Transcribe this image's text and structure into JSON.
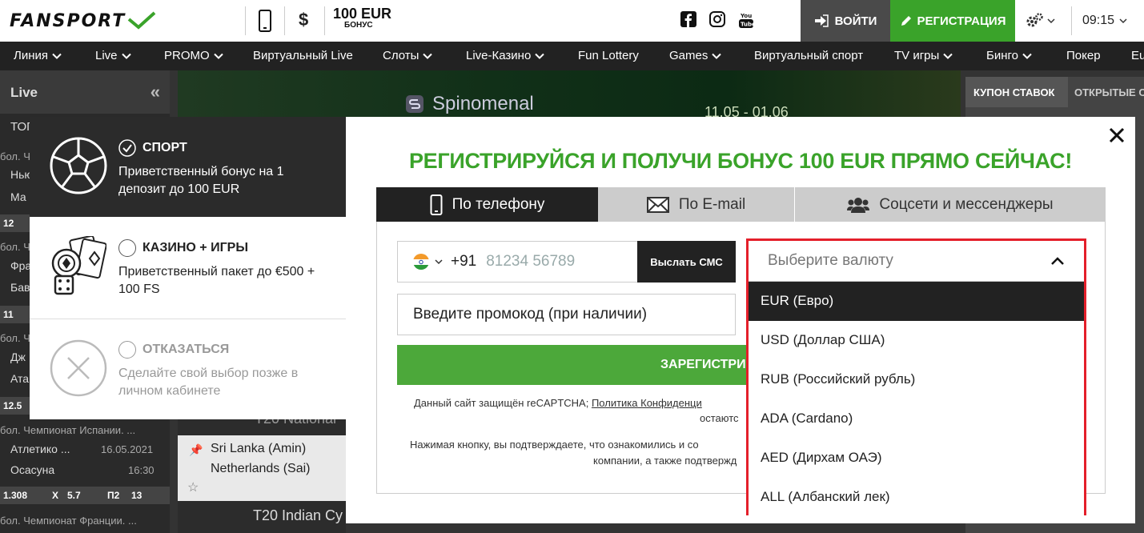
{
  "header": {
    "logo_text": "FANSPORT",
    "bonus_amount": "100 EUR",
    "bonus_label": "БОНУС",
    "login_label": "ВОЙТИ",
    "register_label": "РЕГИСТРАЦИЯ",
    "time": "09:15",
    "currency_symbol": "$"
  },
  "nav": {
    "items": [
      {
        "label": "Линия",
        "arrow": true
      },
      {
        "label": "Live",
        "arrow": true
      },
      {
        "label": "PROMO",
        "arrow": true
      },
      {
        "label": "Виртуальный Live",
        "arrow": false
      },
      {
        "label": "Слоты",
        "arrow": true
      },
      {
        "label": "Live-Казино",
        "arrow": true
      },
      {
        "label": "Fun Lottery",
        "arrow": false
      },
      {
        "label": "Games",
        "arrow": true
      },
      {
        "label": "Виртуальный спорт",
        "arrow": false
      },
      {
        "label": "TV игры",
        "arrow": true
      },
      {
        "label": "Бинго",
        "arrow": true
      },
      {
        "label": "Покер",
        "arrow": false
      },
      {
        "label": "Eu",
        "arrow": false
      }
    ]
  },
  "sidebar": {
    "title": "Live",
    "top_label": "ТОП",
    "lines": [
      "бол. Ч",
      "Нью",
      "Ма",
      "12",
      "бол. Ч",
      "Фра",
      "Бав",
      "11",
      "бол. Ч",
      "Дж",
      "Ата",
      "12.5"
    ],
    "match1": {
      "league": "бол. Чемпионат Испании. ...",
      "team1": "Атлетико ...",
      "date": "16.05.2021",
      "team2": "Осасуна",
      "time": "16:30",
      "odds": [
        "1.308",
        "X",
        "5.7",
        "П2",
        "13"
      ]
    },
    "match2_league": "бол. Чемпионат Франции. ..."
  },
  "background": {
    "spinomenal": "Spinomenal",
    "dates": "11.05 - 01.06",
    "t20_1": "T20 National",
    "team_a": "Sri Lanka (Amin)",
    "team_b": "Netherlands (Sai)",
    "t20_2": "T20 Indian Cy"
  },
  "coupon": {
    "tab1": "КУПОН СТАВОК",
    "tab2": "ОТКРЫТЫЕ С"
  },
  "bonus_options": [
    {
      "title": "СПОРТ",
      "desc": "Приветственный бонус на 1 депозит до 100 EUR",
      "selected": true,
      "icon": "soccer-ball-icon"
    },
    {
      "title": "КАЗИНО + ИГРЫ",
      "desc": "Приветственный пакет до €500 + 100 FS",
      "selected": false,
      "icon": "casino-icon"
    },
    {
      "title": "ОТКАЗАТЬСЯ",
      "desc": "Сделайте свой выбор позже в личном кабинете",
      "selected": false,
      "icon": "decline-icon"
    }
  ],
  "modal": {
    "title": "РЕГИСТРИРУЙСЯ И ПОЛУЧИ БОНУС 100 EUR ПРЯМО СЕЙЧАС!",
    "tabs": [
      {
        "label": "По телефону",
        "active": true,
        "icon": "phone-icon"
      },
      {
        "label": "По E-mail",
        "active": false,
        "icon": "envelope-icon"
      },
      {
        "label": "Соцсети и мессенджеры",
        "active": false,
        "icon": "users-icon"
      }
    ],
    "phone_code": "+91",
    "phone_placeholder": "81234 56789",
    "sms_button": "Выслать СМС",
    "promo_placeholder": "Введите промокод (при наличии)",
    "register_button": "ЗАРЕГИСТРИ",
    "recaptcha_note_1": "Данный сайт защищён reCAPTCHA;",
    "recaptcha_link": "Политика Конфиденци",
    "recaptcha_note_2": "остаютс",
    "agree_note_1": "Нажимая кнопку, вы подтверждаете, что ознакомились и со",
    "agree_note_2": "компании, а также подтвержд"
  },
  "currency": {
    "placeholder": "Выберите валюту",
    "options": [
      {
        "label": "EUR (Евро)",
        "selected": true
      },
      {
        "label": "USD (Доллар США)",
        "selected": false
      },
      {
        "label": "RUB (Российский рубль)",
        "selected": false
      },
      {
        "label": "ADA (Cardano)",
        "selected": false
      },
      {
        "label": "AED (Дирхам ОАЭ)",
        "selected": false
      },
      {
        "label": "ALL (Албанский лек)",
        "selected": false
      }
    ]
  },
  "colors": {
    "brand_green": "#3aa32a",
    "highlight_red": "#e41f2a",
    "dark": "#222222"
  }
}
